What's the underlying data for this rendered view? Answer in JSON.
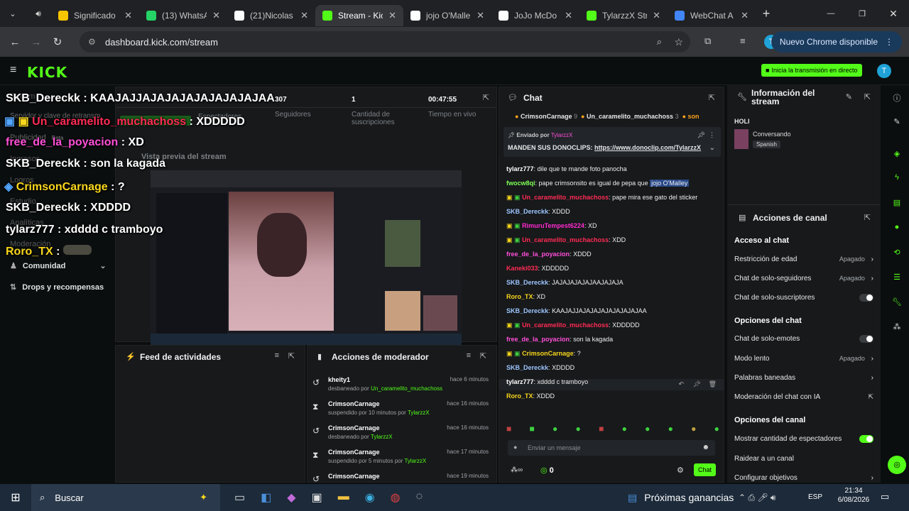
{
  "browser": {
    "tabs": [
      {
        "label": "Significado",
        "color": "#f7c400",
        "icon": "star-icon"
      },
      {
        "label": "(13) WhatsApp",
        "color": "#25d366",
        "icon": "whatsapp-icon"
      },
      {
        "label": "(21)Nicolas",
        "color": "#ffffff",
        "icon": "tiktok-icon"
      },
      {
        "label": "Stream - Kick",
        "color": "#53fc18",
        "icon": "kick-icon"
      },
      {
        "label": "jojo O'Malle",
        "color": "#ffffff",
        "icon": "google-icon"
      },
      {
        "label": "JoJo McDo",
        "color": "#ffffff",
        "icon": "tiktok-icon"
      },
      {
        "label": "TylarzzX Str",
        "color": "#53fc18",
        "icon": "kick-icon"
      },
      {
        "label": "WebChat A",
        "color": "#4285f4",
        "icon": "webchat-icon"
      }
    ],
    "url": "dashboard.kick.com/stream",
    "update_label": "Nuevo Chrome disponible",
    "new_tab": "+"
  },
  "kick": {
    "logo": "KICK",
    "go_live": "Inicia la transmisión en directo",
    "avatar_letter": "T"
  },
  "sidebar": {
    "items": [
      "Stream",
      "Servidor y clave de retransm",
      "Publicidad",
      "Ingresos",
      "Logros",
      "Estudio",
      "Analíticas",
      "Moderación",
      "Comunidad",
      "Drops y recompensas"
    ],
    "beta": "Beta"
  },
  "stream": {
    "stats": [
      {
        "value": "307",
        "label": "Seguidores"
      },
      {
        "value": "1",
        "label": "Cantidad de suscripciones"
      },
      {
        "value": "00:47:55",
        "label": "Tiempo en vivo"
      }
    ],
    "viewers_label": "Espectadores",
    "preview_title": "Vista previa del stream"
  },
  "overlay_chat": [
    {
      "user": "SKB_Dereckk",
      "color": "#ffffff",
      "text": "KAAJAJJAJAJAJAJAJAJAJAJAA"
    },
    {
      "user": "Un_caramelito_muchachoss",
      "color": "#ff2b54",
      "text": "XDDDDD"
    },
    {
      "user": "free_de_la_poyacion",
      "color": "#ff4fd8",
      "text": "XD"
    },
    {
      "user": "SKB_Dereckk",
      "color": "#ffffff",
      "text": "son la kagada"
    },
    {
      "user": "CrimsonCarnage",
      "color": "#f9d71c",
      "text": "?"
    },
    {
      "user": "SKB_Dereckk",
      "color": "#ffffff",
      "text": "XDDDD"
    },
    {
      "user": "tylarz777",
      "color": "#ffffff",
      "text": "xdddd c tramboyo"
    },
    {
      "user": "Roro_TX",
      "color": "#f9d71c",
      "text": ""
    }
  ],
  "feed": {
    "title": "Feed de actividades"
  },
  "mod": {
    "title": "Acciones de moderador",
    "rows": [
      {
        "user": "kheity1",
        "action": "desbaneado por",
        "by": "Un_caramelito_muchachoss",
        "time": "hace 6 minutos",
        "icon": "undo-icon"
      },
      {
        "user": "CrimsonCarnage",
        "action": "suspendido por 10 minutos por",
        "by": "TylarzzX",
        "time": "hace 16 minutos",
        "icon": "hourglass-icon"
      },
      {
        "user": "CrimsonCarnage",
        "action": "desbaneado por",
        "by": "TylarzzX",
        "time": "hace 16 minutos",
        "icon": "undo-icon"
      },
      {
        "user": "CrimsonCarnage",
        "action": "suspendido por 5 minutos por",
        "by": "TylarzzX",
        "time": "hace 17 minutos",
        "icon": "hourglass-icon"
      },
      {
        "user": "CrimsonCarnage",
        "action": "",
        "by": "",
        "time": "hace 19 minutos",
        "icon": "undo-icon"
      }
    ]
  },
  "chat": {
    "title": "Chat",
    "top_gifters": [
      {
        "name": "CrimsonCarnage",
        "count": "9"
      },
      {
        "name": "Un_caramelito_muchachoss",
        "count": "3"
      },
      {
        "name": "son",
        "count": ""
      }
    ],
    "pinned_by_label": "Enviado por",
    "pinned_by": "TylarzzX",
    "pinned_text": "MANDEN SUS DONOCLIPS: ",
    "pinned_link": "https://www.donoclip.com/TylarzzX",
    "messages": [
      {
        "user": "tylarz777",
        "color": "#ffffff",
        "text": "dile que te mande foto panocha"
      },
      {
        "user": "fwocw8qi",
        "color": "#7fff57",
        "text": "pape crimsonsito es igual de pepa que ",
        "mention": "jojo O'Malley"
      },
      {
        "user": "Un_caramelito_muchachoss",
        "color": "#ff2b54",
        "text": "pape mira ese gato del sticker",
        "badges": true
      },
      {
        "user": "SKB_Dereckk",
        "color": "#9ec6ff",
        "text": "XDDD"
      },
      {
        "user": "RimuruTempest6224",
        "color": "#ff2bd0",
        "text": "XD",
        "badges": true
      },
      {
        "user": "Un_caramelito_muchachoss",
        "color": "#ff2b54",
        "text": "XDD",
        "badges": true
      },
      {
        "user": "free_de_la_poyacion",
        "color": "#ff4fd8",
        "text": "XDDD"
      },
      {
        "user": "Kaneki033",
        "color": "#ff2b54",
        "text": "XDDDDD"
      },
      {
        "user": "SKB_Dereckk",
        "color": "#9ec6ff",
        "text": "JAJAJAJAJAJAAJAJAJA"
      },
      {
        "user": "Roro_TX",
        "color": "#f9d71c",
        "text": "XD"
      },
      {
        "user": "SKB_Dereckk",
        "color": "#9ec6ff",
        "text": "KAAJAJJAJAJAJAJAJAJAJAJAA"
      },
      {
        "user": "Un_caramelito_muchachoss",
        "color": "#ff2b54",
        "text": "XDDDDD",
        "badges": true
      },
      {
        "user": "free_de_la_poyacion",
        "color": "#ff4fd8",
        "text": "son la kagada"
      },
      {
        "user": "CrimsonCarnage",
        "color": "#f9d71c",
        "text": "?",
        "badges": true
      },
      {
        "user": "SKB_Dereckk",
        "color": "#9ec6ff",
        "text": "XDDDD"
      },
      {
        "user": "tylarz777",
        "color": "#ffffff",
        "text": "xdddd c tramboyo"
      },
      {
        "user": "Roro_TX",
        "color": "#f9d71c",
        "text": "XDDD"
      }
    ],
    "input_placeholder": "Enviar un mensaje",
    "send_label": "Chat",
    "points": "0"
  },
  "info": {
    "title": "Información del stream",
    "stream_title": "HOLI",
    "category": "Conversando",
    "language": "Spanish"
  },
  "actions": {
    "title": "Acciones de canal",
    "sec_access": "Acceso al chat",
    "age": "Restricción de edad",
    "off": "Apagado",
    "followers": "Chat de solo-seguidores",
    "subs": "Chat de solo-suscriptores",
    "sec_chat": "Opciones del chat",
    "emotes": "Chat de solo-emotes",
    "slow": "Modo lento",
    "banned": "Palabras baneadas",
    "ai": "Moderación del chat con IA",
    "sec_channel": "Opciones del canal",
    "viewers": "Mostrar cantidad de espectadores",
    "raid": "Raidear a un canal",
    "goals": "Configurar objetivos"
  },
  "taskbar": {
    "search": "Buscar",
    "widget": "Próximas ganancias",
    "lang": "ESP",
    "time": "21:34",
    "date": "6/08/2026"
  }
}
